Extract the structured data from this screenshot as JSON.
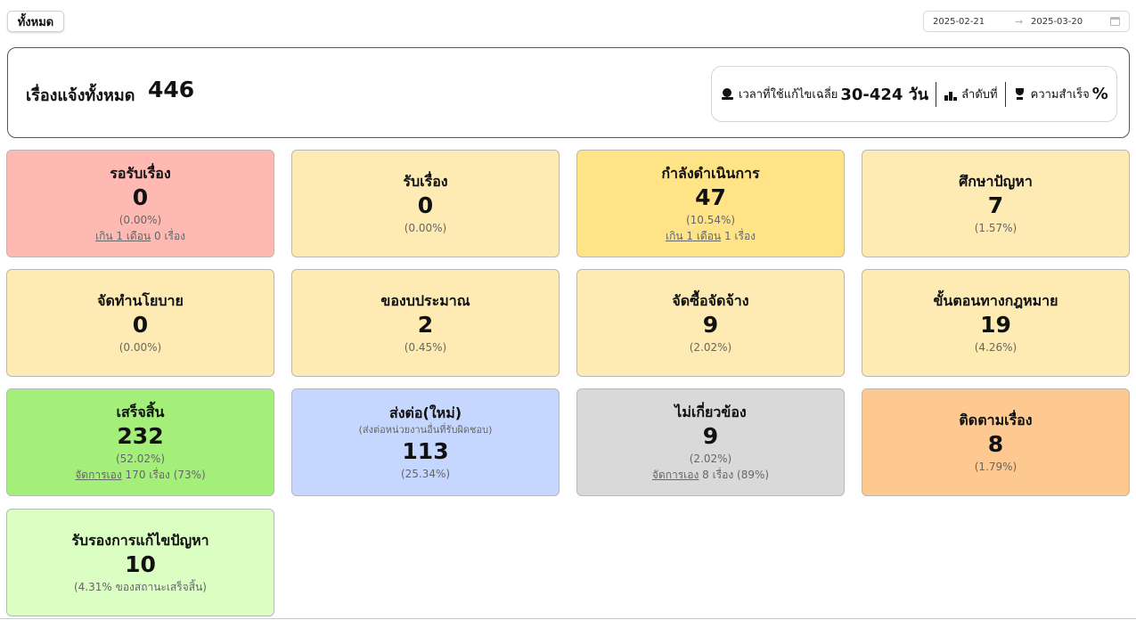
{
  "filter": {
    "label": "ทั้งหมด"
  },
  "date_range": {
    "start": "2025-02-21",
    "arrow": "→",
    "end": "2025-03-20",
    "icon": "calendar-icon"
  },
  "summary": {
    "label": "เรื่องแจ้งทั้งหมด",
    "total": "446",
    "stats": {
      "time_label": "เวลาที่ใช้แก้ไขเฉลี่ย",
      "time_value": "30-424 วัน",
      "rank_label": "ลำดับที่",
      "success_label": "ความสำเร็จ",
      "success_value": "%"
    }
  },
  "colors": {
    "red": "#ffb9b3",
    "yellow_light": "#fdebb3",
    "yellow": "#fee387",
    "green": "#a3ef79",
    "blue": "#c5d7fe",
    "gray": "#d9d9d9",
    "orange": "#fec990",
    "green_light": "#dbfec3"
  },
  "cards": [
    {
      "title": "รอรับเรื่อง",
      "value": "0",
      "pct": "(0.00%)",
      "extra_link": "เกิน 1 เดือน",
      "extra_text": "0 เรื่อง"
    },
    {
      "title": "รับเรื่อง",
      "value": "0",
      "pct": "(0.00%)"
    },
    {
      "title": "กำลังดำเนินการ",
      "value": "47",
      "pct": "(10.54%)",
      "extra_link": "เกิน 1 เดือน",
      "extra_text": "1 เรื่อง"
    },
    {
      "title": "ศึกษาปัญหา",
      "value": "7",
      "pct": "(1.57%)"
    },
    {
      "title": "จัดทำนโยบาย",
      "value": "0",
      "pct": "(0.00%)"
    },
    {
      "title": "ของบประมาณ",
      "value": "2",
      "pct": "(0.45%)"
    },
    {
      "title": "จัดซื้อจัดจ้าง",
      "value": "9",
      "pct": "(2.02%)"
    },
    {
      "title": "ขั้นตอนทางกฎหมาย",
      "value": "19",
      "pct": "(4.26%)"
    },
    {
      "title": "เสร็จสิ้น",
      "value": "232",
      "pct": "(52.02%)",
      "extra_link": "จัดการเอง",
      "extra_text": "170 เรื่อง (73%)"
    },
    {
      "title": "ส่งต่อ(ใหม่)",
      "subtitle": "(ส่งต่อหน่วยงานอื่นที่รับผิดชอบ)",
      "value": "113",
      "pct": "(25.34%)"
    },
    {
      "title": "ไม่เกี่ยวข้อง",
      "value": "9",
      "pct": "(2.02%)",
      "extra_link": "จัดการเอง",
      "extra_text": "8 เรื่อง (89%)"
    },
    {
      "title": "ติดตามเรื่อง",
      "value": "8",
      "pct": "(1.79%)"
    },
    {
      "title": "รับรองการแก้ไขปัญหา",
      "value": "10",
      "pct": "(4.31% ของสถานะเสร็จสิ้น)"
    }
  ]
}
